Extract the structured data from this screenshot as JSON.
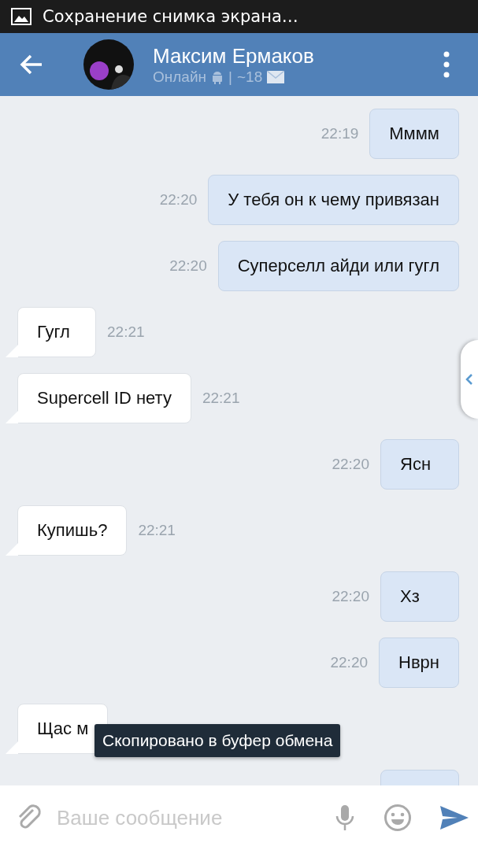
{
  "status_bar": {
    "notification": "Сохранение снимка экрана…"
  },
  "header": {
    "name": "Максим Ермаков",
    "status": "Онлайн",
    "separator": "|",
    "age": "~18"
  },
  "messages": [
    {
      "outgoing": true,
      "text": "Мммм",
      "time": "22:19"
    },
    {
      "outgoing": true,
      "text": "У тебя он к чему привязан",
      "time": "22:20"
    },
    {
      "outgoing": true,
      "text": "Суперселл айди или гугл",
      "time": "22:20"
    },
    {
      "outgoing": false,
      "text": "Гугл",
      "time": "22:21"
    },
    {
      "outgoing": false,
      "text": "Supercell ID нету",
      "time": "22:21"
    },
    {
      "outgoing": true,
      "text": "Ясн",
      "time": "22:20"
    },
    {
      "outgoing": false,
      "text": "Купишь?",
      "time": "22:21"
    },
    {
      "outgoing": true,
      "text": "Хз",
      "time": "22:20"
    },
    {
      "outgoing": true,
      "text": "Нврн",
      "time": "22:20"
    },
    {
      "outgoing": false,
      "text": "Щас м"
    },
    {
      "outgoing": true
    }
  ],
  "toast": "Скопировано в буфер обмена",
  "composer": {
    "placeholder": "Ваше сообщение"
  }
}
